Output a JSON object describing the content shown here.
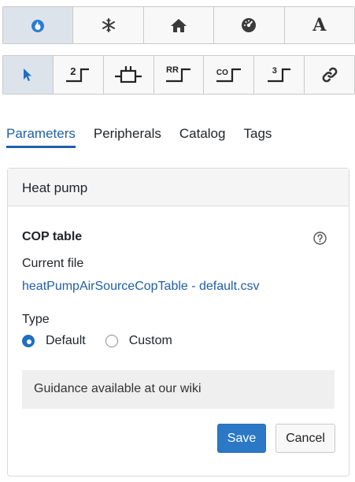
{
  "toolbar_top": {
    "buttons": [
      {
        "icon": "flame-icon",
        "active": true
      },
      {
        "icon": "snowflake-icon",
        "active": false
      },
      {
        "icon": "home-icon",
        "active": false
      },
      {
        "icon": "gauge-icon",
        "active": false
      },
      {
        "icon": "letter-a-icon",
        "label": "A",
        "active": false
      }
    ]
  },
  "toolbar_second": {
    "buttons": [
      {
        "icon": "pointer-icon",
        "active": true
      },
      {
        "icon": "step-2-icon",
        "label": "2"
      },
      {
        "icon": "connector-icon"
      },
      {
        "icon": "step-rr-icon",
        "label": "RR"
      },
      {
        "icon": "step-co-icon",
        "label": "CO"
      },
      {
        "icon": "step-3-icon",
        "label": "3"
      },
      {
        "icon": "link-icon"
      }
    ]
  },
  "tabs": [
    {
      "label": "Parameters",
      "active": true
    },
    {
      "label": "Peripherals",
      "active": false
    },
    {
      "label": "Catalog",
      "active": false
    },
    {
      "label": "Tags",
      "active": false
    }
  ],
  "panel": {
    "title": "Heat pump",
    "section_title": "COP table",
    "current_file_label": "Current file",
    "current_file": "heatPumpAirSourceCopTable - default.csv",
    "type_label": "Type",
    "type_options": [
      {
        "label": "Default",
        "checked": true
      },
      {
        "label": "Custom",
        "checked": false
      }
    ],
    "guidance": "Guidance available at our wiki",
    "save_label": "Save",
    "cancel_label": "Cancel"
  },
  "colors": {
    "accent": "#1f5fa8",
    "save_button": "#2a78c6",
    "toolbar_active": "#dde3ea"
  }
}
